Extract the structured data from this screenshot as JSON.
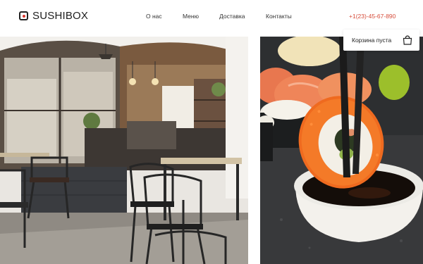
{
  "header": {
    "logo_text": "SUSHIBOX",
    "nav": [
      "О нас",
      "Меню",
      "Доставка",
      "Контакты"
    ],
    "phone": "+1(23)-45-67-890"
  },
  "cart": {
    "label": "Корзина пуста",
    "icon": "shopping-bag-icon"
  },
  "images": {
    "left": "restaurant-interior-photo",
    "right": "sushi-roll-with-chopsticks-photo"
  },
  "colors": {
    "accent": "#d64c3a",
    "text": "#222222",
    "background": "#ffffff"
  }
}
